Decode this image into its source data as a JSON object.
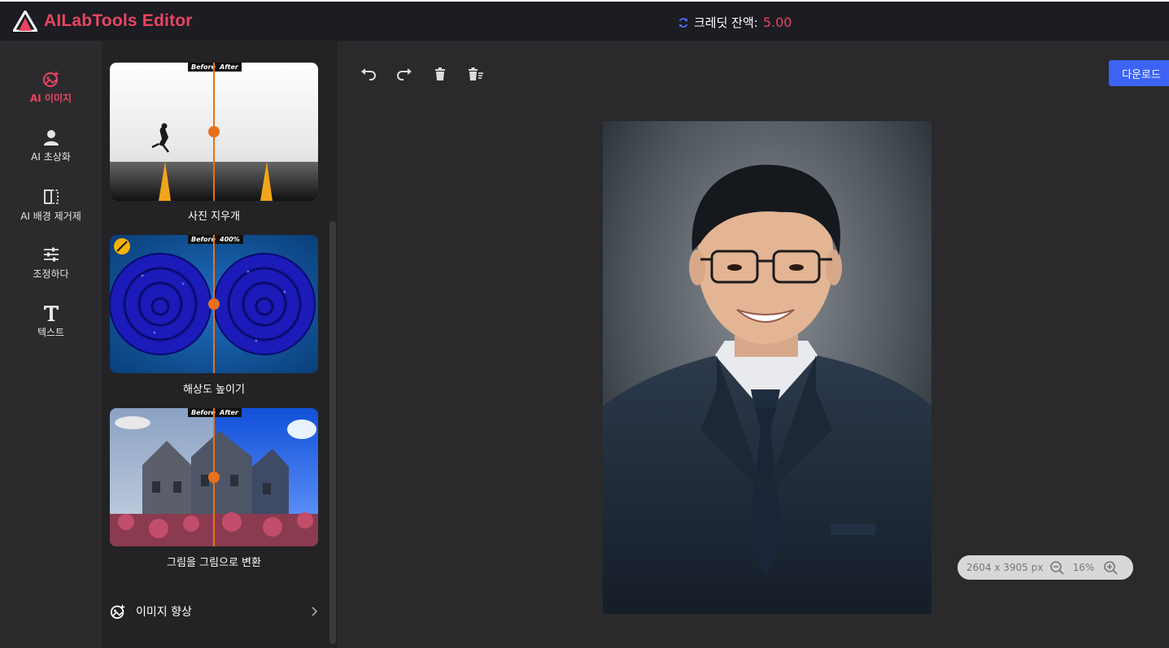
{
  "header": {
    "app_title": "AILabTools Editor",
    "credit_label": "크레딧 잔액:",
    "credit_value": "5.00",
    "brand_color": "#e94560"
  },
  "sidebar": {
    "items": [
      {
        "label": "AI 이미지",
        "icon": "ai-image-icon",
        "active": true
      },
      {
        "label": "AI 초상화",
        "icon": "portrait-icon"
      },
      {
        "label": "AI 배경 제거제",
        "icon": "background-remove-icon"
      },
      {
        "label": "조정하다",
        "icon": "adjust-sliders-icon"
      },
      {
        "label": "텍스트",
        "icon": "text-icon"
      }
    ]
  },
  "panel": {
    "cards": [
      {
        "label": "사진 지우개",
        "tag_left": "Before",
        "tag_right": "After"
      },
      {
        "label": "해상도 높이기",
        "tag_left": "Before",
        "tag_right": "400%"
      },
      {
        "label": "그림을 그림으로 변환",
        "tag_left": "Before",
        "tag_right": "After"
      }
    ],
    "enhance_label": "이미지 향상"
  },
  "toolbar": {
    "buttons": [
      "undo-icon",
      "redo-icon",
      "delete-icon",
      "delete-all-icon"
    ],
    "download_label": "다운로드"
  },
  "canvas": {
    "dimensions": "2604 x 3905 px",
    "zoom": "16%"
  }
}
